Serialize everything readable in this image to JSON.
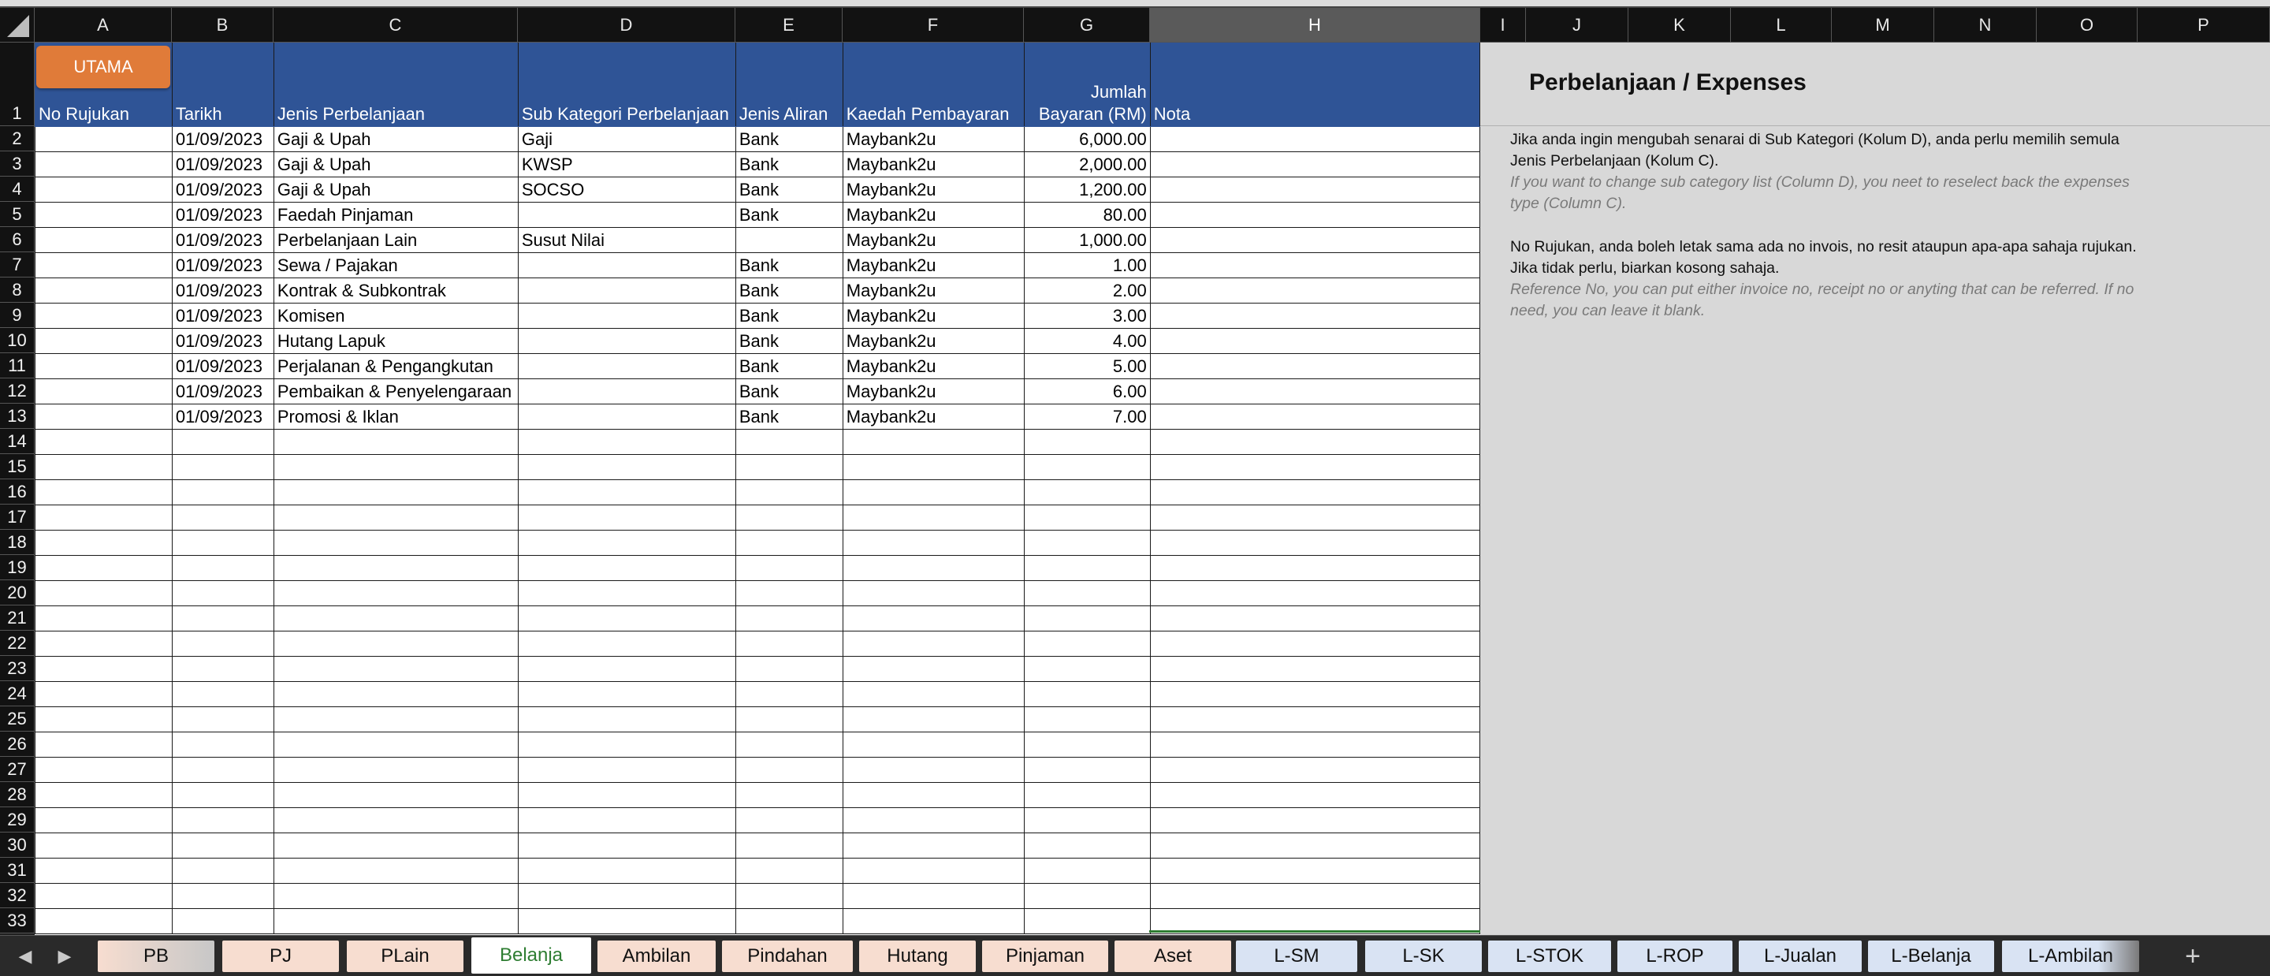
{
  "columns": [
    "A",
    "B",
    "C",
    "D",
    "E",
    "F",
    "G",
    "H",
    "I",
    "J",
    "K",
    "L",
    "M",
    "N",
    "O",
    "P"
  ],
  "selected_column": "H",
  "utama_button": "UTAMA",
  "headers": {
    "a": "No Rujukan",
    "b": "Tarikh",
    "c": "Jenis Perbelanjaan",
    "d": "Sub Kategori Perbelanjaan",
    "e": "Jenis Aliran",
    "f": "Kaedah Pembayaran",
    "g1": "Jumlah",
    "g2": "Bayaran (RM)",
    "h": "Nota"
  },
  "rows": [
    {
      "num": "2",
      "a": "",
      "b": "01/09/2023",
      "c": "Gaji & Upah",
      "d": "Gaji",
      "e": "Bank",
      "f": "Maybank2u",
      "g": "6,000.00",
      "h": ""
    },
    {
      "num": "3",
      "a": "",
      "b": "01/09/2023",
      "c": "Gaji & Upah",
      "d": "KWSP",
      "e": "Bank",
      "f": "Maybank2u",
      "g": "2,000.00",
      "h": ""
    },
    {
      "num": "4",
      "a": "",
      "b": "01/09/2023",
      "c": "Gaji & Upah",
      "d": "SOCSO",
      "e": "Bank",
      "f": "Maybank2u",
      "g": "1,200.00",
      "h": ""
    },
    {
      "num": "5",
      "a": "",
      "b": "01/09/2023",
      "c": "Faedah Pinjaman",
      "d": "",
      "e": "Bank",
      "f": "Maybank2u",
      "g": "80.00",
      "h": ""
    },
    {
      "num": "6",
      "a": "",
      "b": "01/09/2023",
      "c": "Perbelanjaan Lain",
      "d": "Susut Nilai",
      "e": "",
      "f": "Maybank2u",
      "g": "1,000.00",
      "h": ""
    },
    {
      "num": "7",
      "a": "",
      "b": "01/09/2023",
      "c": "Sewa / Pajakan",
      "d": "",
      "e": "Bank",
      "f": "Maybank2u",
      "g": "1.00",
      "h": ""
    },
    {
      "num": "8",
      "a": "",
      "b": "01/09/2023",
      "c": "Kontrak & Subkontrak",
      "d": "",
      "e": "Bank",
      "f": "Maybank2u",
      "g": "2.00",
      "h": ""
    },
    {
      "num": "9",
      "a": "",
      "b": "01/09/2023",
      "c": "Komisen",
      "d": "",
      "e": "Bank",
      "f": "Maybank2u",
      "g": "3.00",
      "h": ""
    },
    {
      "num": "10",
      "a": "",
      "b": "01/09/2023",
      "c": "Hutang Lapuk",
      "d": "",
      "e": "Bank",
      "f": "Maybank2u",
      "g": "4.00",
      "h": ""
    },
    {
      "num": "11",
      "a": "",
      "b": "01/09/2023",
      "c": "Perjalanan & Pengangkutan",
      "d": "",
      "e": "Bank",
      "f": "Maybank2u",
      "g": "5.00",
      "h": ""
    },
    {
      "num": "12",
      "a": "",
      "b": "01/09/2023",
      "c": "Pembaikan & Penyelengaraan",
      "d": "",
      "e": "Bank",
      "f": "Maybank2u",
      "g": "6.00",
      "h": ""
    },
    {
      "num": "13",
      "a": "",
      "b": "01/09/2023",
      "c": "Promosi & Iklan",
      "d": "",
      "e": "Bank",
      "f": "Maybank2u",
      "g": "7.00",
      "h": ""
    }
  ],
  "empty_rows": [
    "14",
    "15",
    "16",
    "17",
    "18",
    "19",
    "20",
    "21",
    "22",
    "23",
    "24",
    "25",
    "26",
    "27",
    "28",
    "29",
    "30",
    "31",
    "32",
    "33"
  ],
  "panel": {
    "title": "Perbelanjaan / Expenses",
    "note1_ms": "Jika anda ingin mengubah senarai di Sub Kategori (Kolum D), anda perlu memilih semula Jenis Perbelanjaan (Kolum C).",
    "note1_en": "If you want to change sub category list (Column D), you neet to reselect back the expenses type (Column C).",
    "note2_ms": "No Rujukan, anda boleh letak sama ada no invois, no resit ataupun apa-apa sahaja rujukan. Jika tidak perlu, biarkan kosong sahaja.",
    "note2_en": "Reference No, you can put either invoice no, receipt no or anyting that can be referred. If no need, you can leave it blank."
  },
  "tabs": [
    {
      "label": "PB",
      "style": "fade"
    },
    {
      "label": "PJ",
      "style": "warm"
    },
    {
      "label": "PLain",
      "style": "warm"
    },
    {
      "label": "Belanja",
      "style": "active"
    },
    {
      "label": "Ambilan",
      "style": "warm"
    },
    {
      "label": "Pindahan",
      "style": "warm"
    },
    {
      "label": "Hutang",
      "style": "warm"
    },
    {
      "label": "Pinjaman",
      "style": "warm"
    },
    {
      "label": "Aset",
      "style": "warm"
    },
    {
      "label": "L-SM",
      "style": "cool"
    },
    {
      "label": "L-SK",
      "style": "cool"
    },
    {
      "label": "L-STOK",
      "style": "cool"
    },
    {
      "label": "L-ROP",
      "style": "cool"
    },
    {
      "label": "L-Jualan",
      "style": "cool"
    },
    {
      "label": "L-Belanja",
      "style": "cool"
    },
    {
      "label": "L-Ambilan",
      "style": "fadecool"
    }
  ],
  "colors": {
    "header_fill": "#2f5496",
    "utama_fill": "#e07b39",
    "active_tab_text": "#2e7d32",
    "panel_fill": "#d8d8d8"
  },
  "icons": {
    "prev": "triangle-left-icon",
    "next": "triangle-right-icon",
    "add": "plus-icon"
  }
}
